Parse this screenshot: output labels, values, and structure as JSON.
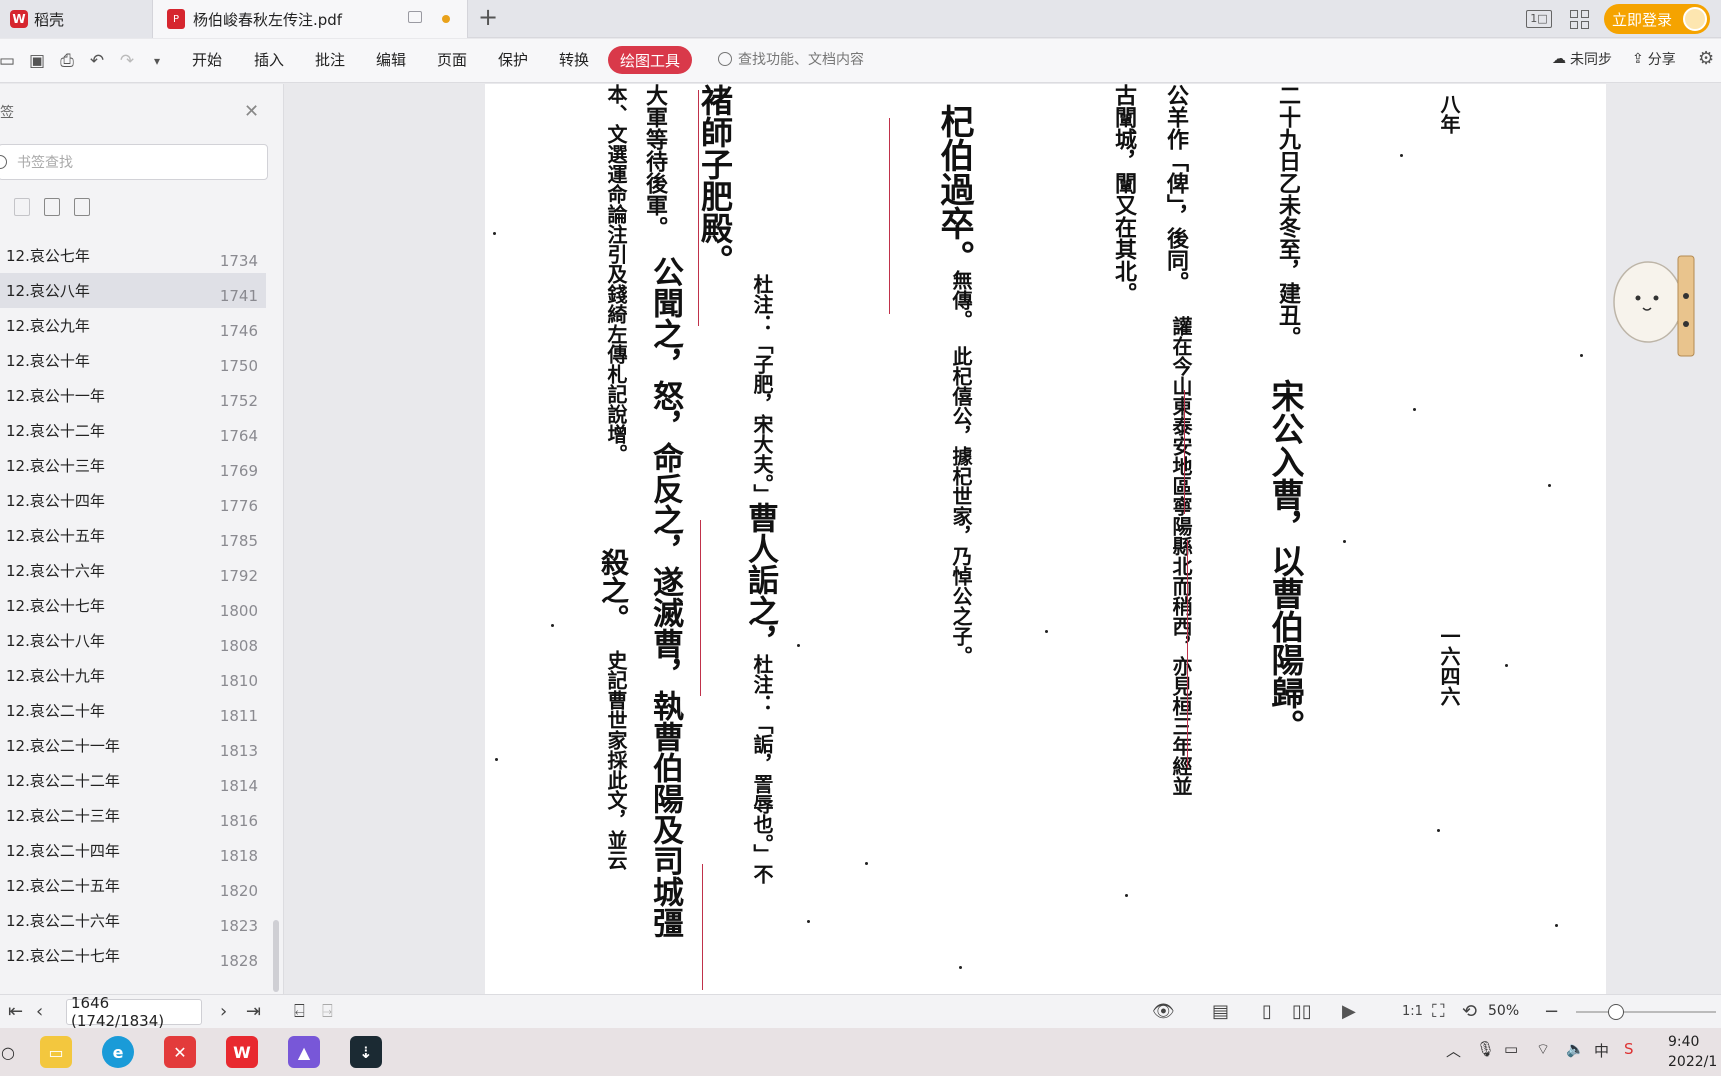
{
  "tabs": {
    "home_label": "稻壳",
    "doc_label": "杨伯峻春秋左传注.pdf",
    "login_label": "立即登录"
  },
  "toolbar": {
    "menu": [
      "开始",
      "插入",
      "批注",
      "编辑",
      "页面",
      "保护",
      "转换"
    ],
    "active_label": "绘图工具",
    "search_placeholder": "查找功能、文档内容",
    "sync_label": "未同步",
    "share_label": "分享"
  },
  "sidebar": {
    "bookmark_search_placeholder": "书签查找",
    "items": [
      {
        "label": "12.哀公七年",
        "page": "1734"
      },
      {
        "label": "12.哀公八年",
        "page": "1741"
      },
      {
        "label": "12.哀公九年",
        "page": "1746"
      },
      {
        "label": "12.哀公十年",
        "page": "1750"
      },
      {
        "label": "12.哀公十一年",
        "page": "1752"
      },
      {
        "label": "12.哀公十二年",
        "page": "1764"
      },
      {
        "label": "12.哀公十三年",
        "page": "1769"
      },
      {
        "label": "12.哀公十四年",
        "page": "1776"
      },
      {
        "label": "12.哀公十五年",
        "page": "1785"
      },
      {
        "label": "12.哀公十六年",
        "page": "1792"
      },
      {
        "label": "12.哀公十七年",
        "page": "1800"
      },
      {
        "label": "12.哀公十八年",
        "page": "1808"
      },
      {
        "label": "12.哀公十九年",
        "page": "1810"
      },
      {
        "label": "12.哀公二十年",
        "page": "1811"
      },
      {
        "label": "12.哀公二十一年",
        "page": "1813"
      },
      {
        "label": "12.哀公二十二年",
        "page": "1814"
      },
      {
        "label": "12.哀公二十三年",
        "page": "1816"
      },
      {
        "label": "12.哀公二十四年",
        "page": "1818"
      },
      {
        "label": "12.哀公二十五年",
        "page": "1820"
      },
      {
        "label": "12.哀公二十六年",
        "page": "1823"
      },
      {
        "label": "12.哀公二十七年",
        "page": "1828"
      }
    ]
  },
  "document": {
    "header_year": "八年",
    "page_number": "一六四六",
    "columns": [
      "二十九日乙未冬至，建丑。",
      "宋公入曹，以曹伯陽歸。",
      "公羊作「俾」，後同。",
      "讙在今山東泰安地區寧陽縣北而稍西，亦見桓三年經並",
      "古闡城，闡又在其北。",
      "杞伯過卒。",
      "無傳。",
      "此杞僖公，據杞世家，乃悼公之子。",
      "褚師子肥殿。",
      "杜注：「子肥，宋大夫。」",
      "曹人詬之，",
      "杜注：「詬，詈辱也。」不",
      "公聞之，怒，命反之，遂滅曹，執曹伯陽及司城彊",
      "大軍等待後軍。",
      "殺之。",
      "本、文選運命論注引及錢綺左傳札記說增。",
      "史記曹世家採此文，並云"
    ]
  },
  "status": {
    "page_indicator": "1646 (1742/1834)",
    "zoom": "50%"
  },
  "system": {
    "time": "9:40",
    "date": "2022/1"
  }
}
